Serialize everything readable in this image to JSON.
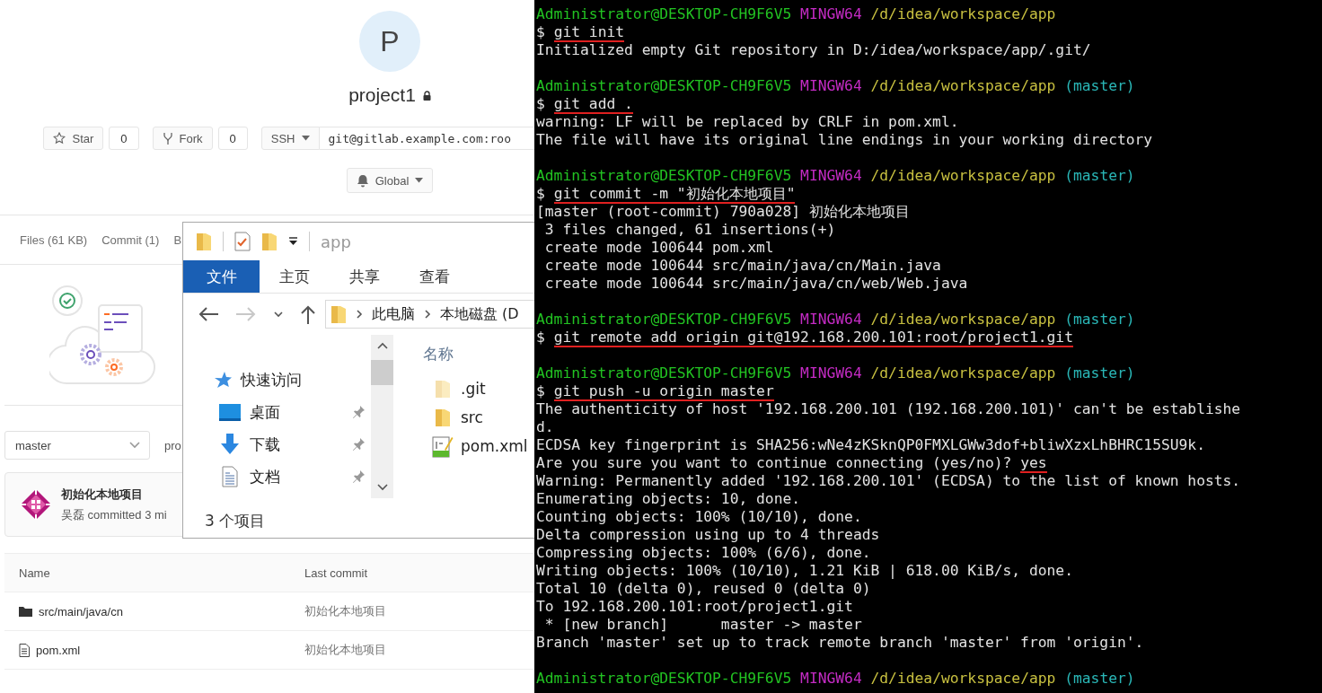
{
  "gitlab": {
    "avatar_letter": "P",
    "project_name": "project1",
    "private": true,
    "star": {
      "label": "Star",
      "count": "0"
    },
    "fork": {
      "label": "Fork",
      "count": "0"
    },
    "clone": {
      "protocol": "SSH",
      "url": "git@gitlab.example.com:roo"
    },
    "notification": "Global",
    "tabs": [
      {
        "label": "Files (61 KB)"
      },
      {
        "label": "Commit (1)"
      },
      {
        "label": "B"
      }
    ],
    "branch": "master",
    "path": "pro",
    "last_commit": {
      "message": "初始化本地项目",
      "meta": "吴磊 committed 3 mi"
    },
    "table": {
      "columns": [
        "Name",
        "Last commit"
      ],
      "rows": [
        {
          "kind": "folder",
          "name": "src/main/java/cn",
          "last_commit": "初始化本地项目"
        },
        {
          "kind": "file",
          "name": "pom.xml",
          "last_commit": "初始化本地项目"
        }
      ]
    }
  },
  "explorer": {
    "title": "app",
    "ribbon_tabs": [
      {
        "label": "文件",
        "selected": true
      },
      {
        "label": "主页",
        "selected": false
      },
      {
        "label": "共享",
        "selected": false
      },
      {
        "label": "查看",
        "selected": false
      }
    ],
    "nav_buttons": [
      {
        "kind": "back",
        "disabled": false
      },
      {
        "kind": "forward",
        "disabled": true
      },
      {
        "kind": "recent",
        "disabled": false
      },
      {
        "kind": "up",
        "disabled": false
      }
    ],
    "breadcrumb": [
      "此电脑",
      "本地磁盘 (D"
    ],
    "nav": [
      {
        "kind": "star",
        "label": "快速访问",
        "pinned": false
      },
      {
        "kind": "desktop",
        "label": "桌面",
        "pinned": true
      },
      {
        "kind": "download",
        "label": "下载",
        "pinned": true
      },
      {
        "kind": "document",
        "label": "文档",
        "pinned": true
      }
    ],
    "column": "名称",
    "items": [
      {
        "kind": "folder",
        "name": ".git",
        "hidden": true
      },
      {
        "kind": "folder",
        "name": "src",
        "hidden": false
      },
      {
        "kind": "xml",
        "name": "pom.xml",
        "hidden": false
      }
    ],
    "status": "3 个项目"
  },
  "terminal": {
    "lines": [
      {
        "kind": "prompt",
        "user": "Administrator@DESKTOP-CH9F6V5",
        "shell": "MINGW64",
        "path": "/d/idea/workspace/app"
      },
      {
        "kind": "command",
        "symbol": "$",
        "text": "git init",
        "marked": true
      },
      {
        "kind": "output",
        "text": "Initialized empty Git repository in D:/idea/workspace/app/.git/"
      },
      {
        "kind": "blank"
      },
      {
        "kind": "prompt",
        "user": "Administrator@DESKTOP-CH9F6V5",
        "shell": "MINGW64",
        "path": "/d/idea/workspace/app",
        "branch": "(master)"
      },
      {
        "kind": "command",
        "symbol": "$",
        "text": "git add .",
        "marked": true
      },
      {
        "kind": "output",
        "text": "warning: LF will be replaced by CRLF in pom.xml."
      },
      {
        "kind": "output",
        "text": "The file will have its original line endings in your working directory"
      },
      {
        "kind": "blank"
      },
      {
        "kind": "prompt",
        "user": "Administrator@DESKTOP-CH9F6V5",
        "shell": "MINGW64",
        "path": "/d/idea/workspace/app",
        "branch": "(master)"
      },
      {
        "kind": "command",
        "symbol": "$",
        "text": "git commit -m \"初始化本地项目\"",
        "marked": true
      },
      {
        "kind": "output",
        "text": "[master (root-commit) 790a028] 初始化本地项目"
      },
      {
        "kind": "output",
        "text": " 3 files changed, 61 insertions(+)"
      },
      {
        "kind": "output",
        "text": " create mode 100644 pom.xml"
      },
      {
        "kind": "output",
        "text": " create mode 100644 src/main/java/cn/Main.java"
      },
      {
        "kind": "output",
        "text": " create mode 100644 src/main/java/cn/web/Web.java"
      },
      {
        "kind": "blank"
      },
      {
        "kind": "prompt",
        "user": "Administrator@DESKTOP-CH9F6V5",
        "shell": "MINGW64",
        "path": "/d/idea/workspace/app",
        "branch": "(master)"
      },
      {
        "kind": "command",
        "symbol": "$",
        "text": "git remote add origin git@192.168.200.101:root/project1.git",
        "marked": true
      },
      {
        "kind": "blank"
      },
      {
        "kind": "prompt",
        "user": "Administrator@DESKTOP-CH9F6V5",
        "shell": "MINGW64",
        "path": "/d/idea/workspace/app",
        "branch": "(master)"
      },
      {
        "kind": "command",
        "symbol": "$",
        "text": "git push -u origin master",
        "marked": true
      },
      {
        "kind": "output",
        "text": "The authenticity of host '192.168.200.101 (192.168.200.101)' can't be establishe"
      },
      {
        "kind": "output",
        "text": "d."
      },
      {
        "kind": "output",
        "text": "ECDSA key fingerprint is SHA256:wNe4zKSknQP0FMXLGWw3dof+bliwXzxLhBHRC15SU9k."
      },
      {
        "kind": "answer",
        "text": "Are you sure you want to continue connecting (yes/no)?",
        "answer": "yes",
        "marked": true
      },
      {
        "kind": "output",
        "text": "Warning: Permanently added '192.168.200.101' (ECDSA) to the list of known hosts."
      },
      {
        "kind": "output",
        "text": "Enumerating objects: 10, done."
      },
      {
        "kind": "output",
        "text": "Counting objects: 100% (10/10), done."
      },
      {
        "kind": "output",
        "text": "Delta compression using up to 4 threads"
      },
      {
        "kind": "output",
        "text": "Compressing objects: 100% (6/6), done."
      },
      {
        "kind": "output",
        "text": "Writing objects: 100% (10/10), 1.21 KiB | 618.00 KiB/s, done."
      },
      {
        "kind": "output",
        "text": "Total 10 (delta 0), reused 0 (delta 0)"
      },
      {
        "kind": "output",
        "text": "To 192.168.200.101:root/project1.git"
      },
      {
        "kind": "output",
        "text": " * [new branch]      master -> master"
      },
      {
        "kind": "output",
        "text": "Branch 'master' set up to track remote branch 'master' from 'origin'."
      },
      {
        "kind": "blank"
      },
      {
        "kind": "prompt",
        "user": "Administrator@DESKTOP-CH9F6V5",
        "shell": "MINGW64",
        "path": "/d/idea/workspace/app",
        "branch": "(master)"
      }
    ]
  }
}
